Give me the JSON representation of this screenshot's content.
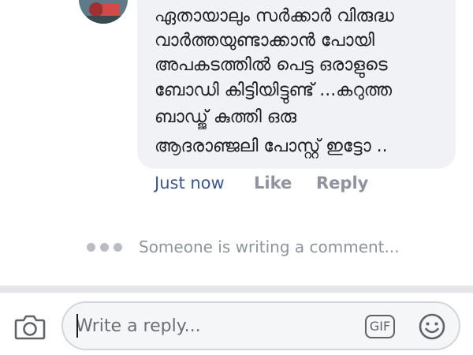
{
  "comment": {
    "lines": [
      "ഏതായാലും സർക്കാർ വിരുദ്ധ",
      "വാർത്തയുണ്ടാക്കാൻ പോയി",
      "അപകടത്തിൽ പെട്ട ഒരാളുടെ",
      "ബോഡി കിട്ടിയിട്ടുണ്ട് ...കറുത്ത",
      "ബാഡ്ജ് കുത്തി ഒരു",
      "ആദരാഞ്ജലി പോസ്റ്റ് ഇട്ടോ .."
    ],
    "time": "Just now",
    "like_label": "Like",
    "reply_label": "Reply"
  },
  "typing_indicator": "Someone is writing a comment...",
  "composer": {
    "placeholder": "Write a reply...",
    "gif_label": "GIF"
  },
  "icons": {
    "camera": "camera-icon",
    "gif": "gif-icon",
    "emoji": "smiley-icon",
    "typing": "typing-dots-icon"
  }
}
